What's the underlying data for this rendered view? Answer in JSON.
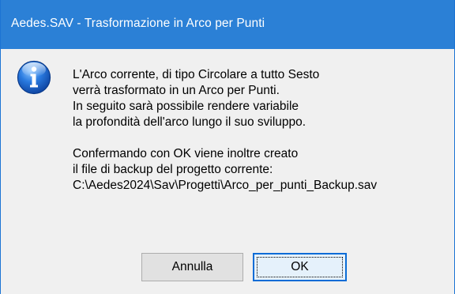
{
  "window": {
    "title": "Aedes.SAV - Trasformazione in Arco per Punti",
    "accent_color": "#2b80d6"
  },
  "icon": {
    "name": "info-icon"
  },
  "message": {
    "lines": [
      "L'Arco corrente, di tipo Circolare a tutto Sesto",
      "verrà trasformato in un Arco per Punti.",
      "In seguito sarà possibile rendere variabile",
      "la profondità dell'arco lungo il suo sviluppo.",
      "",
      "Confermando con OK viene inoltre creato",
      "il file di backup del progetto corrente:",
      "C:\\Aedes2024\\Sav\\Progetti\\Arco_per_punti_Backup.sav"
    ]
  },
  "buttons": {
    "cancel_label": "Annulla",
    "ok_label": "OK"
  }
}
